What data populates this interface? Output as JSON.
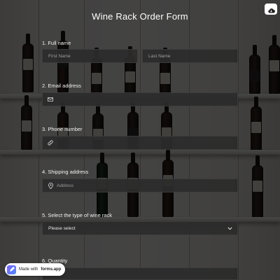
{
  "form": {
    "title": "Wine Rack Order Form",
    "questions": [
      {
        "label": "1. Full name",
        "fields": [
          {
            "placeholder": "First Name"
          },
          {
            "placeholder": "Last Name"
          }
        ]
      },
      {
        "label": "2. Email address",
        "fields": [
          {
            "icon": "envelope-icon",
            "placeholder": ""
          }
        ]
      },
      {
        "label": "3. Phone number",
        "fields": [
          {
            "icon": "phone-icon",
            "placeholder": ""
          }
        ]
      },
      {
        "label": "4. Shipping address",
        "fields": [
          {
            "icon": "location-pin-icon",
            "placeholder": "Address"
          }
        ]
      },
      {
        "label": "5. Select the type of wine rack",
        "fields": [
          {
            "selected": "Please select",
            "icon": "chevron-down-icon"
          }
        ]
      },
      {
        "label": "6. Quantity",
        "fields": []
      }
    ]
  },
  "header": {
    "cloud_icon": "cloud-icon"
  },
  "badge": {
    "prefix": "Made with",
    "brand": "forms.app",
    "icon": "forms-app-logo-icon"
  },
  "colors": {
    "overlay": "#000000b8",
    "field_bg": "#2c2c2c",
    "text": "#ffffff",
    "placeholder": "#9d9d9d"
  }
}
